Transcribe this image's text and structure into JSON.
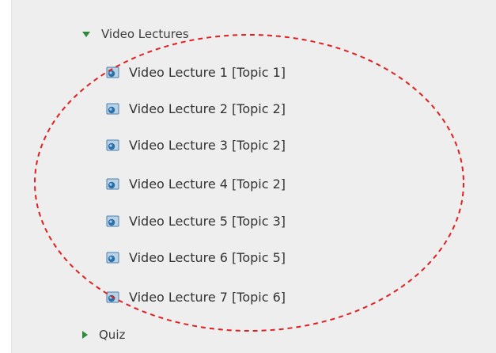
{
  "tree": {
    "folder_video": {
      "label": "Video Lectures",
      "icon": "caret-down-icon",
      "expanded": true
    },
    "items": [
      {
        "label": "Video Lecture 1 [Topic 1]",
        "icon": "video-icon"
      },
      {
        "label": "Video Lecture 2 [Topic 2]",
        "icon": "video-icon"
      },
      {
        "label": "Video Lecture 3 [Topic 2]",
        "icon": "video-icon"
      },
      {
        "label": "Video Lecture 4 [Topic 2]",
        "icon": "video-icon"
      },
      {
        "label": "Video Lecture 5 [Topic 3]",
        "icon": "video-icon"
      },
      {
        "label": "Video Lecture 6 [Topic 5]",
        "icon": "video-icon"
      },
      {
        "label": "Video Lecture 7 [Topic 6]",
        "icon": "video-icon"
      }
    ],
    "folder_quiz": {
      "label": "Quiz",
      "icon": "caret-right-icon",
      "expanded": false
    }
  },
  "colors": {
    "caret": "#2e8b3a",
    "annotation_circle": "#e02020",
    "panel_background": "#eeeeee"
  },
  "annotation": {
    "shape": "dashed-ellipse",
    "target": "video-lecture-items"
  }
}
